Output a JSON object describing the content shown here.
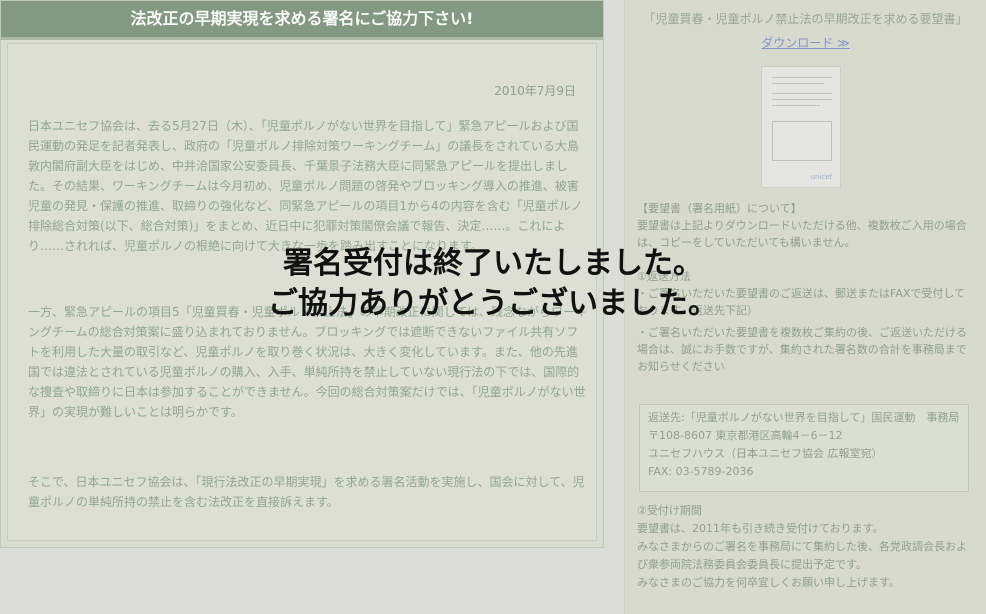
{
  "left": {
    "header": "法改正の早期実現を求める署名にご協力下さい!",
    "date": "2010年7月9日",
    "paragraphs": [
      "日本ユニセフ協会は、去る5月27日（木）、「児童ポルノがない世界を目指して」緊急アピールおよび国民運動の発足を記者発表し、政府の「児童ポルノ排除対策ワーキングチーム」の議長をされている大島敦内閣府副大臣をはじめ、中井洽国家公安委員長、千葉景子法務大臣に同緊急アピールを提出しました。その結果、ワーキングチームは今月初め、児童ポルノ問題の啓発やブロッキング導入の推進、被害児童の発見・保護の推進、取締りの強化など、同緊急アピールの項目1から4の内容を含む「児童ポルノ排除総合対策(以下、総合対策)」をまとめ、近日中に犯罪対策閣僚会議で報告、決定……。これにより……されれば、児童ポルノの根絶に向けて大きな一歩を踏み出すことになります。",
      "一方、緊急アピールの項目5「児童買春・児童ポルノ禁止法」の早期改正に関しては、残念ながらワーキングチームの総合対策案に盛り込まれておりません。ブロッキングでは遮断できないファイル共有ソフトを利用した大量の取引など、児童ポルノを取り巻く状況は、大きく変化しています。また、他の先進国では違法とされている児童ポルノの購入、入手、単純所持を禁止していない現行法の下では、国際的な捜査や取締りに日本は参加することができません。今回の総合対策案だけでは、「児童ポルノがない世界」の実現が難しいことは明らかです。",
      "そこで、日本ユニセフ協会は、「現行法改正の早期実現」を求める署名活動を実施し、国会に対して、児童ポルノの単純所持の禁止を含む法改正を直接訴えます。"
    ]
  },
  "right": {
    "title": "「児童買春・児童ポルノ禁止法の早期改正を求める要望書」",
    "download": "ダウンロード ≫",
    "doc_logo": "unicef",
    "block1": "【要望書（署名用紙）について】\n要望書は上記よりダウンロードいただける他、複数枚ご入用の場合は、コピーをしていただいても構いません。",
    "block2": "①返送方法\n・ご署名いただいた要望書のご返送は、郵送またはFAXで受付しております（返送先下記）",
    "block3": "・ご署名いただいた要望書を複数枚ご集約の後、ご返送いただける場合は、誠にお手数ですが、集約された署名数の合計を事務局までお知らせください",
    "address": [
      "返送先:「児童ポルノがない世界を目指して」国民運動　事務局",
      "〒108-8607 東京都港区高輪4－6－12",
      "ユニセフハウス（日本ユニセフ協会 広報室宛）",
      "FAX: 03-5789-2036"
    ],
    "period": "②受付け期間\n要望書は、2011年も引き続き受付けております。\nみなさまからのご署名を事務局にて集約した後、各党政調会長および衆参両院法務委員会委員長に提出予定です。\nみなさまのご協力を何卒宜しくお願い申し上げます。"
  },
  "overlay": {
    "line1": "署名受付は終了いたしました。",
    "line2": "ご協力ありがとうございました。"
  }
}
